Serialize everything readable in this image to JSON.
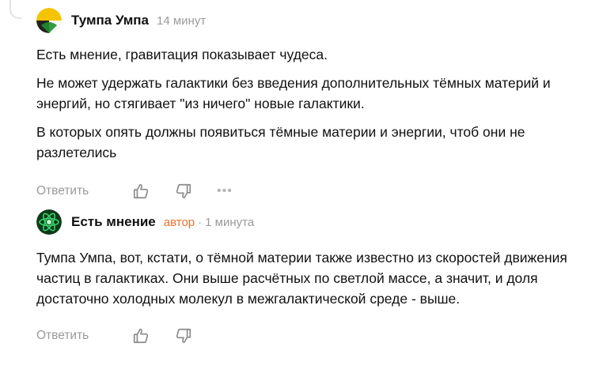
{
  "comments": [
    {
      "author": "Тумпа Умпа",
      "time": "14 минут",
      "paragraphs": [
        "Есть мнение, гравитация показывает чудеса.",
        "Не может удержать галактики без введения дополнительных тёмных материй и энергий, но стягивает \"из ничего\" новые галактики.",
        "В которых опять должны появиться тёмные материи и энергии, чтоб они не разлетелись"
      ],
      "reply_label": "Ответить",
      "more_label": "•••"
    },
    {
      "author": "Есть мнение",
      "badge": "автор",
      "dot": "·",
      "time": "1 минута",
      "paragraphs": [
        "Тумпа Умпа, вот, кстати, о тёмной материи также известно из скоростей движения частиц в галактиках. Они выше расчётных по светлой массе, а значит, и доля достаточно холодных молекул в межгалактической среде - выше."
      ],
      "reply_label": "Ответить"
    }
  ],
  "colors": {
    "author_badge": "#f0702e",
    "muted": "#9a9a9a",
    "avatar1_yellow": "#f5c400",
    "avatar2_green": "#1f8a3a"
  },
  "icons": [
    "like-icon",
    "dislike-icon",
    "more-icon"
  ]
}
